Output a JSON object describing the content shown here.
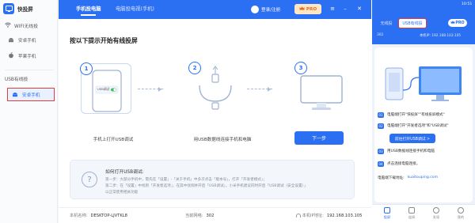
{
  "app": {
    "name": "快投屏",
    "sidebar": {
      "wifi_title": "WIFI无线投",
      "wifi_items": [
        "安卓手机",
        "苹果手机"
      ],
      "usb_title": "USB有线投",
      "usb_items": [
        "安卓手机"
      ]
    },
    "tabs": [
      "手机投电脑",
      "电脑投电视(手机)"
    ],
    "login": "登录/注册",
    "pro_badge": "PRO",
    "main": {
      "heading": "按以下提示开始有线投屏",
      "steps": [
        {
          "num": "1",
          "caption": "手机上打开USB调试"
        },
        {
          "num": "2",
          "caption": "用USB数据线连接手机和电脑"
        },
        {
          "num": "3",
          "caption": ""
        }
      ],
      "usb_label": "USB调试",
      "next_button": "下一步",
      "help": {
        "title": "如何打开USB调试:",
        "lines": [
          "第一步：大部分手机中，需先在「设置」-「关于手机」中多次点击「版本号」，打开「开发者模式」；",
          "第二步：在「设置」中找到「开发者选项」，在其中找到并开启「USB调试」，小米手机建议同时开启「USB调试（安全设置）」",
          "以正常使用相关功能"
        ]
      }
    },
    "footer": {
      "pc_name_label": "本机名称:",
      "pc_name_value": "DESKTOP-LJVTKL8",
      "network_label": "当前网络:",
      "network_value": "302",
      "ip_label": "本机IP地址:",
      "ip_value": "192.168.103.105"
    }
  },
  "phone": {
    "status_time": "10:51",
    "tabs": [
      "无线投",
      "USB有线投"
    ],
    "pro_badge": "PRO",
    "network": "302",
    "ip": "本机IP: 192.168.103.105",
    "steps": [
      {
        "num": "01",
        "text": "电脑端打开\"快投屏\"\"有线投屏模式\""
      },
      {
        "num": "02",
        "text": "电脑端打开\"开发者选项\"和\"USB调试\""
      },
      {
        "num": "03",
        "text": "用USB数据线连接手机和电脑"
      },
      {
        "num": "04",
        "text": "点击连接电脑连接。"
      }
    ],
    "open_usb_button": "前往打开USB调试 >",
    "download_label": "电脑端下载地址:",
    "download_link": "kuaitouping.com",
    "nav": [
      "投屏",
      "连接",
      "发现",
      "我的"
    ]
  },
  "colors": {
    "primary": "#2b6ff2",
    "highlight_border": "#e43c3c",
    "pro": "#e36b1b"
  }
}
